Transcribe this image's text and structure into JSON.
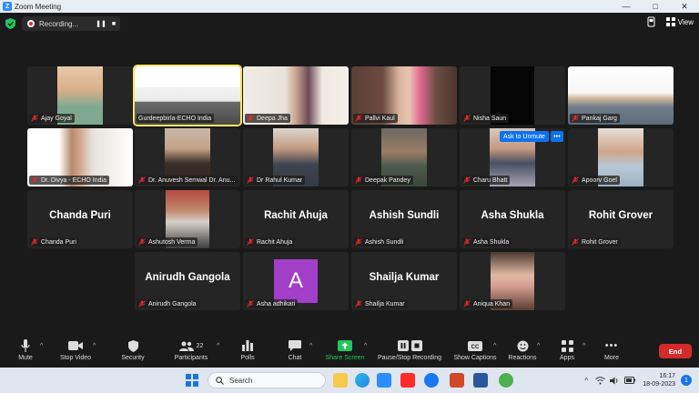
{
  "window": {
    "title": "Zoom Meeting"
  },
  "topbar": {
    "recording_label": "Recording...",
    "view_label": "View"
  },
  "unmute_popup": {
    "ask_label": "Ask to Unmute",
    "more_label": "•••"
  },
  "participants": [
    {
      "id": "ajay",
      "name": "Ajay Goyal",
      "kind": "video",
      "muted": true,
      "active": false
    },
    {
      "id": "gurdeep",
      "name": "Gurdeepbirla-ECHO India",
      "kind": "video",
      "muted": false,
      "active": true
    },
    {
      "id": "deepa",
      "name": "Deepa Jha",
      "kind": "video",
      "muted": true,
      "active": false
    },
    {
      "id": "pallvi",
      "name": "Pallvi Kaul",
      "kind": "video",
      "muted": true,
      "active": false
    },
    {
      "id": "nisha",
      "name": "Nisha Saun",
      "kind": "video",
      "muted": true,
      "active": false
    },
    {
      "id": "pankaj",
      "name": "Pankaj Garg",
      "kind": "video",
      "muted": true,
      "active": false
    },
    {
      "id": "divya",
      "name": "Dr. Divya - ECHO India",
      "kind": "video",
      "muted": true,
      "active": false
    },
    {
      "id": "anuvesh",
      "name": "Dr. Anuvesh Semwal Dr. Anu...",
      "kind": "video",
      "muted": true,
      "active": false
    },
    {
      "id": "rahul",
      "name": "Dr Rahul Kumar",
      "kind": "video",
      "muted": true,
      "active": false
    },
    {
      "id": "deepak",
      "name": "Deepak Pandey",
      "kind": "video",
      "muted": true,
      "active": false
    },
    {
      "id": "charu",
      "name": "Charu Bhatt",
      "kind": "video",
      "muted": true,
      "active": false
    },
    {
      "id": "apoorv",
      "name": "Apoorv Goel",
      "kind": "video",
      "muted": true,
      "active": false
    },
    {
      "id": "chanda",
      "name": "Chanda Puri",
      "big": "Chanda Puri",
      "kind": "name",
      "muted": true,
      "active": false
    },
    {
      "id": "ashutosh",
      "name": "Ashutosh Verma",
      "kind": "video",
      "muted": true,
      "active": false
    },
    {
      "id": "rachit",
      "name": "Rachit Ahuja",
      "big": "Rachit Ahuja",
      "kind": "name",
      "muted": true,
      "active": false
    },
    {
      "id": "ashish",
      "name": "Ashish Sundli",
      "big": "Ashish Sundli",
      "kind": "name",
      "muted": true,
      "active": false
    },
    {
      "id": "asha",
      "name": "Asha Shukla",
      "big": "Asha Shukla",
      "kind": "name",
      "muted": true,
      "active": false
    },
    {
      "id": "rohit",
      "name": "Rohit Grover",
      "big": "Rohit Grover",
      "kind": "name",
      "muted": true,
      "active": false
    },
    {
      "id": "anirudh",
      "name": "Anirudh Gangola",
      "big": "Anirudh Gangola",
      "kind": "name",
      "muted": true,
      "active": false
    },
    {
      "id": "ashaadh",
      "name": "Asha adhikari",
      "avatar": "A",
      "kind": "avatar",
      "muted": true,
      "active": false
    },
    {
      "id": "shailja",
      "name": "Shailja Kumar",
      "big": "Shailja Kumar",
      "kind": "name",
      "muted": true,
      "active": false
    },
    {
      "id": "aniqua",
      "name": "Aniqua Khan",
      "kind": "video",
      "muted": true,
      "active": false
    }
  ],
  "toolbar": {
    "mute": "Mute",
    "stop_video": "Stop Video",
    "security": "Security",
    "participants": "Participants",
    "participants_count": "22",
    "polls": "Polls",
    "chat": "Chat",
    "share_screen": "Share Screen",
    "record": "Pause/Stop Recording",
    "captions": "Show Captions",
    "reactions": "Reactions",
    "apps": "Apps",
    "more": "More",
    "end": "End"
  },
  "taskbar": {
    "search_label": "Search",
    "time": "16:17",
    "date": "18-09-2023",
    "notifications": "1"
  },
  "colors": {
    "accent_blue": "#0e72ed",
    "end_red": "#d42a2a",
    "muted_red": "#e02828",
    "active_speaker": "#f5e663",
    "share_green": "#22c55e",
    "avatar_purple": "#a23fc9"
  }
}
